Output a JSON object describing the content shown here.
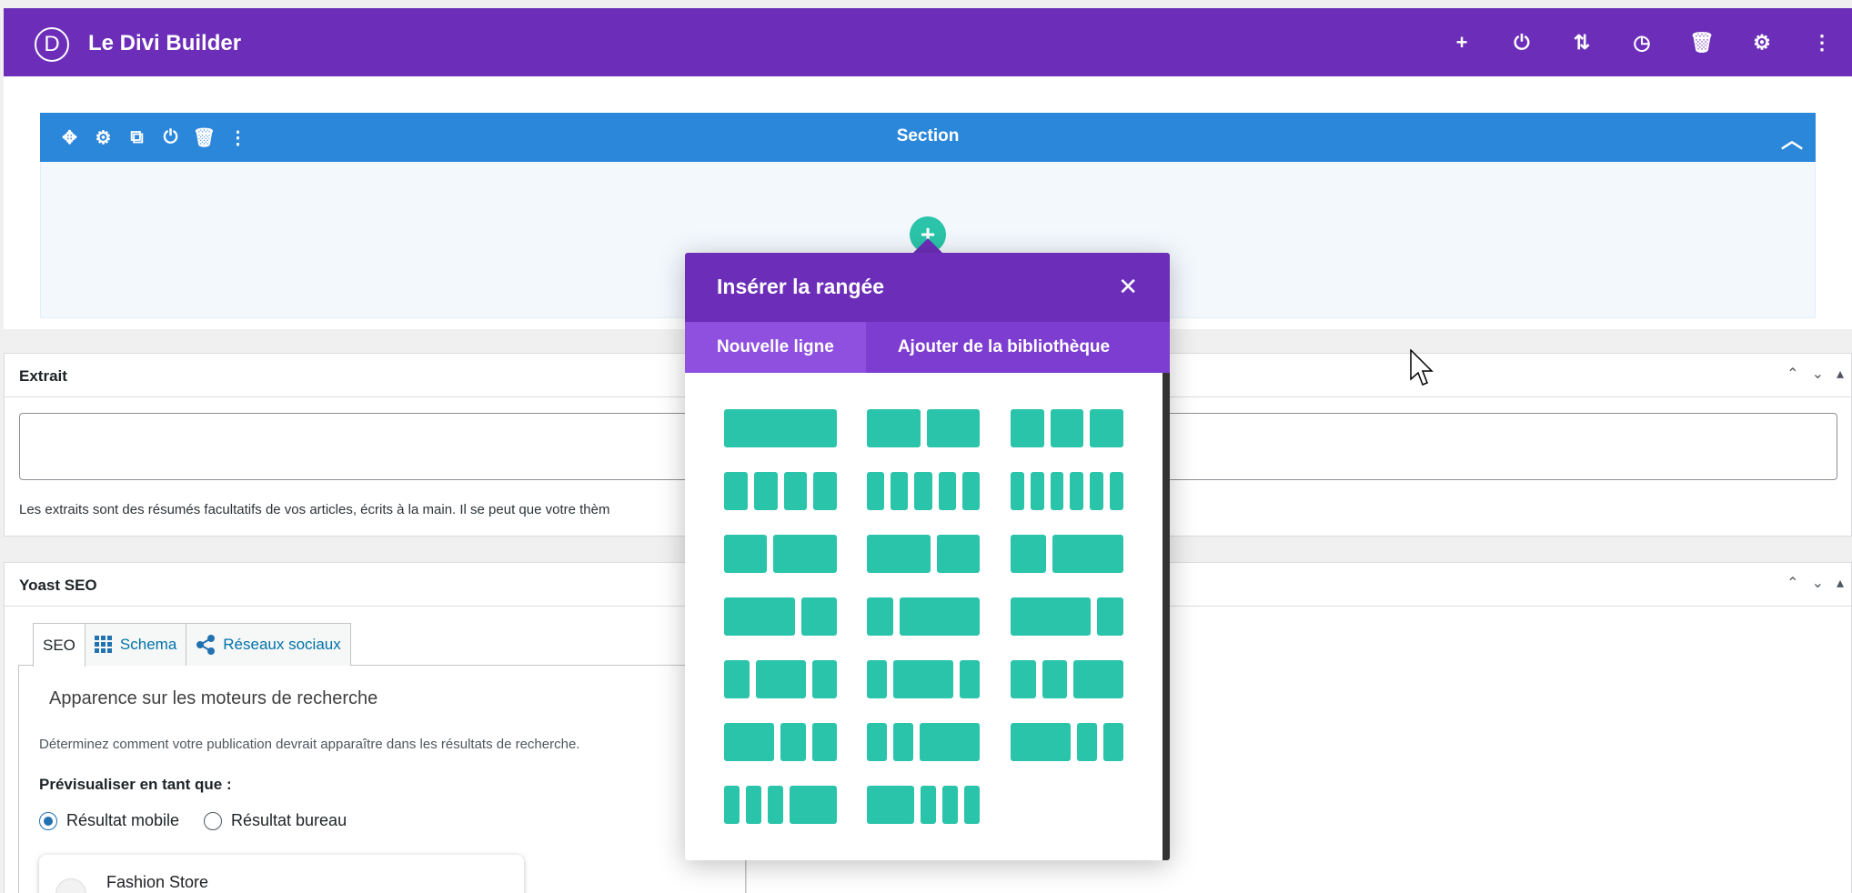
{
  "divi_bar": {
    "logo_letter": "D",
    "title": "Le Divi Builder",
    "actions": [
      {
        "name": "add-icon",
        "glyph": "+"
      },
      {
        "name": "power-icon",
        "glyph": "⏻"
      },
      {
        "name": "sort-icon",
        "glyph": "⇅"
      },
      {
        "name": "history-icon",
        "glyph": "◷"
      },
      {
        "name": "trash-icon",
        "glyph": "🗑"
      },
      {
        "name": "gear-icon",
        "glyph": "⚙"
      },
      {
        "name": "more-vertical-icon",
        "glyph": "⋮"
      }
    ],
    "color": "#6c2eb9"
  },
  "section": {
    "title": "Section",
    "tools": [
      {
        "name": "move-icon",
        "glyph": "✥"
      },
      {
        "name": "gear-icon",
        "glyph": "⚙"
      },
      {
        "name": "duplicate-icon",
        "glyph": "⧉"
      },
      {
        "name": "power-icon",
        "glyph": "⏻"
      },
      {
        "name": "trash-icon",
        "glyph": "🗑"
      },
      {
        "name": "more-vertical-icon",
        "glyph": "⋮"
      }
    ],
    "collapse_glyph": "︿",
    "add_glyph": "+",
    "color": "#2b87da"
  },
  "excerpt": {
    "title": "Extrait",
    "help": "Les extraits sont des résumés facultatifs de vos articles, écrits à la main. Il se peut que votre thèm"
  },
  "yoast": {
    "title": "Yoast SEO",
    "tabs": [
      "SEO",
      "Schema",
      "Réseaux sociaux"
    ],
    "heading": "Apparence sur les moteurs de recherche",
    "subtext": "Déterminez comment votre publication devrait apparaître dans les résultats de recherche.",
    "preview_label": "Prévisualiser en tant que :",
    "radios": [
      "Résultat mobile",
      "Résultat bureau"
    ],
    "preview_site": "Fashion Store"
  },
  "postbox_ctrls": [
    "⌃",
    "⌄",
    "▴"
  ],
  "modal": {
    "title": "Insérer la rangée",
    "close_glyph": "✕",
    "tabs": [
      "Nouvelle ligne",
      "Ajouter de la bibliothèque"
    ],
    "accent": "#29c4a9",
    "layouts": [
      [
        1
      ],
      [
        1,
        1
      ],
      [
        1,
        1,
        1
      ],
      [
        1,
        1,
        1,
        1
      ],
      [
        1,
        1,
        1,
        1,
        1
      ],
      [
        1,
        1,
        1,
        1,
        1,
        1
      ],
      [
        2,
        3
      ],
      [
        3,
        2
      ],
      [
        1,
        2
      ],
      [
        2,
        1
      ],
      [
        1,
        3
      ],
      [
        3,
        1
      ],
      [
        1,
        2,
        1
      ],
      [
        1,
        3,
        1
      ],
      [
        1,
        1,
        2
      ],
      [
        2,
        1,
        1
      ],
      [
        1,
        1,
        3
      ],
      [
        3,
        1,
        1
      ],
      [
        1,
        1,
        1,
        3
      ],
      [
        3,
        1,
        1,
        1
      ]
    ]
  }
}
